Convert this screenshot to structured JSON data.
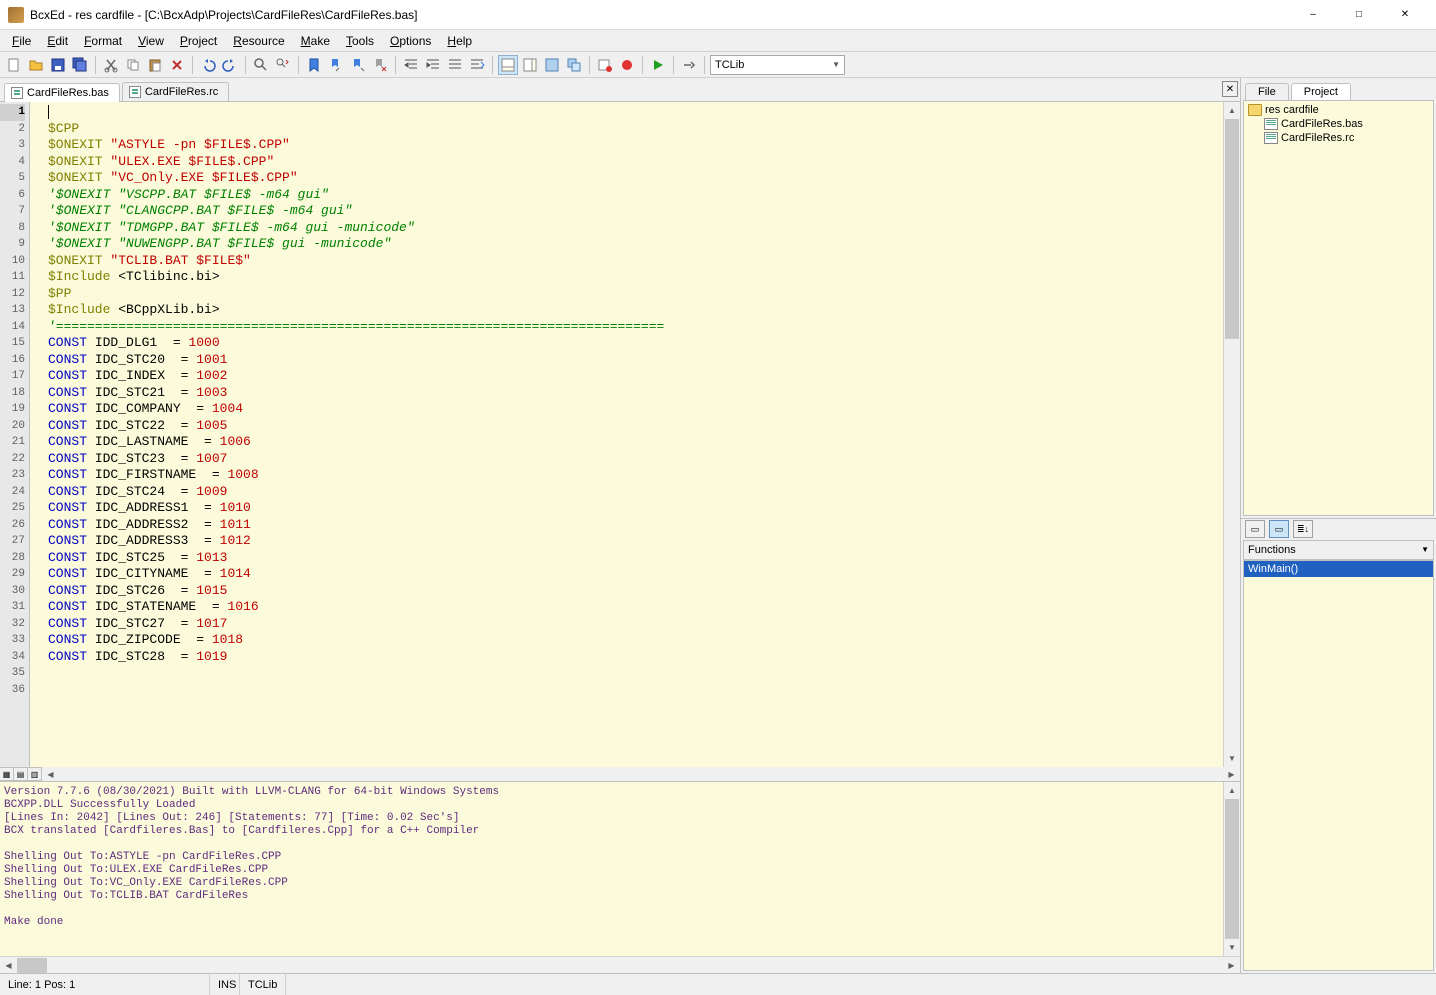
{
  "title": "BcxEd - res cardfile - [C:\\BcxAdp\\Projects\\CardFileRes\\CardFileRes.bas]",
  "menus": [
    "File",
    "Edit",
    "Format",
    "View",
    "Project",
    "Resource",
    "Make",
    "Tools",
    "Options",
    "Help"
  ],
  "toolbar_combo": "TCLib",
  "editor_tabs": [
    {
      "label": "CardFileRes.bas",
      "active": true
    },
    {
      "label": "CardFileRes.rc",
      "active": false
    }
  ],
  "code_lines": [
    {
      "n": 1,
      "html": ""
    },
    {
      "n": 2,
      "html": "<span class='dir'>$CPP</span>"
    },
    {
      "n": 3,
      "html": "<span class='dir'>$ONEXIT</span> <span class='str'>\"ASTYLE -pn $FILE$.CPP\"</span>"
    },
    {
      "n": 4,
      "html": "<span class='dir'>$ONEXIT</span> <span class='str'>\"ULEX.EXE $FILE$.CPP\"</span>"
    },
    {
      "n": 5,
      "html": "<span class='dir'>$ONEXIT</span> <span class='str'>\"VC_Only.EXE $FILE$.CPP\"</span>"
    },
    {
      "n": 6,
      "html": "<span class='cmt'>'$ONEXIT \"VSCPP.BAT $FILE$ -m64 gui\"</span>"
    },
    {
      "n": 7,
      "html": "<span class='cmt'>'$ONEXIT \"CLANGCPP.BAT $FILE$ -m64 gui\"</span>"
    },
    {
      "n": 8,
      "html": "<span class='cmt'>'$ONEXIT \"TDMGPP.BAT $FILE$ -m64 gui -municode\"</span>"
    },
    {
      "n": 9,
      "html": "<span class='cmt'>'$ONEXIT \"NUWENGPP.BAT $FILE$ gui -municode\"</span>"
    },
    {
      "n": 10,
      "html": "<span class='dir'>$ONEXIT</span> <span class='str'>\"TCLIB.BAT $FILE$\"</span>"
    },
    {
      "n": 11,
      "html": "<span class='dir'>$Include</span> &lt;TClibinc.bi&gt;"
    },
    {
      "n": 12,
      "html": "<span class='dir'>$PP</span>"
    },
    {
      "n": 13,
      "html": ""
    },
    {
      "n": 14,
      "html": "<span class='dir'>$Include</span> &lt;BCppXLib.bi&gt;"
    },
    {
      "n": 15,
      "html": ""
    },
    {
      "n": 16,
      "html": "<span class='cmt'>'==============================================================================</span>"
    },
    {
      "n": 17,
      "html": "<span class='kw'>CONST</span> IDD_DLG1  = <span class='num'>1000</span>"
    },
    {
      "n": 18,
      "html": "<span class='kw'>CONST</span> IDC_STC20  = <span class='num'>1001</span>"
    },
    {
      "n": 19,
      "html": "<span class='kw'>CONST</span> IDC_INDEX  = <span class='num'>1002</span>"
    },
    {
      "n": 20,
      "html": "<span class='kw'>CONST</span> IDC_STC21  = <span class='num'>1003</span>"
    },
    {
      "n": 21,
      "html": "<span class='kw'>CONST</span> IDC_COMPANY  = <span class='num'>1004</span>"
    },
    {
      "n": 22,
      "html": "<span class='kw'>CONST</span> IDC_STC22  = <span class='num'>1005</span>"
    },
    {
      "n": 23,
      "html": "<span class='kw'>CONST</span> IDC_LASTNAME  = <span class='num'>1006</span>"
    },
    {
      "n": 24,
      "html": "<span class='kw'>CONST</span> IDC_STC23  = <span class='num'>1007</span>"
    },
    {
      "n": 25,
      "html": "<span class='kw'>CONST</span> IDC_FIRSTNAME  = <span class='num'>1008</span>"
    },
    {
      "n": 26,
      "html": "<span class='kw'>CONST</span> IDC_STC24  = <span class='num'>1009</span>"
    },
    {
      "n": 27,
      "html": "<span class='kw'>CONST</span> IDC_ADDRESS1  = <span class='num'>1010</span>"
    },
    {
      "n": 28,
      "html": "<span class='kw'>CONST</span> IDC_ADDRESS2  = <span class='num'>1011</span>"
    },
    {
      "n": 29,
      "html": "<span class='kw'>CONST</span> IDC_ADDRESS3  = <span class='num'>1012</span>"
    },
    {
      "n": 30,
      "html": "<span class='kw'>CONST</span> IDC_STC25  = <span class='num'>1013</span>"
    },
    {
      "n": 31,
      "html": "<span class='kw'>CONST</span> IDC_CITYNAME  = <span class='num'>1014</span>"
    },
    {
      "n": 32,
      "html": "<span class='kw'>CONST</span> IDC_STC26  = <span class='num'>1015</span>"
    },
    {
      "n": 33,
      "html": "<span class='kw'>CONST</span> IDC_STATENAME  = <span class='num'>1016</span>"
    },
    {
      "n": 34,
      "html": "<span class='kw'>CONST</span> IDC_STC27  = <span class='num'>1017</span>"
    },
    {
      "n": 35,
      "html": "<span class='kw'>CONST</span> IDC_ZIPCODE  = <span class='num'>1018</span>"
    },
    {
      "n": 36,
      "html": "<span class='kw'>CONST</span> IDC_STC28  = <span class='num'>1019</span>"
    }
  ],
  "output_lines": [
    "Version 7.7.6 (08/30/2021) Built with LLVM-CLANG for 64-bit Windows Systems",
    "BCXPP.DLL Successfully Loaded",
    "[Lines In: 2042] [Lines Out: 246] [Statements: 77] [Time: 0.02 Sec's]",
    "BCX translated [Cardfileres.Bas] to [Cardfileres.Cpp] for a C++ Compiler",
    "",
    "Shelling Out To:ASTYLE -pn CardFileRes.CPP",
    "Shelling Out To:ULEX.EXE CardFileRes.CPP",
    "Shelling Out To:VC_Only.EXE CardFileRes.CPP",
    "Shelling Out To:TCLIB.BAT CardFileRes",
    "",
    "Make done"
  ],
  "right_tabs": [
    {
      "label": "File",
      "active": false
    },
    {
      "label": "Project",
      "active": true
    }
  ],
  "project_tree": {
    "root": "res cardfile",
    "files": [
      "CardFileRes.bas",
      "CardFileRes.rc"
    ]
  },
  "functions_header": "Functions",
  "functions_list": [
    "WinMain()"
  ],
  "status": {
    "pos": "Line: 1 Pos: 1",
    "mode": "INS",
    "compiler": "TCLib"
  }
}
